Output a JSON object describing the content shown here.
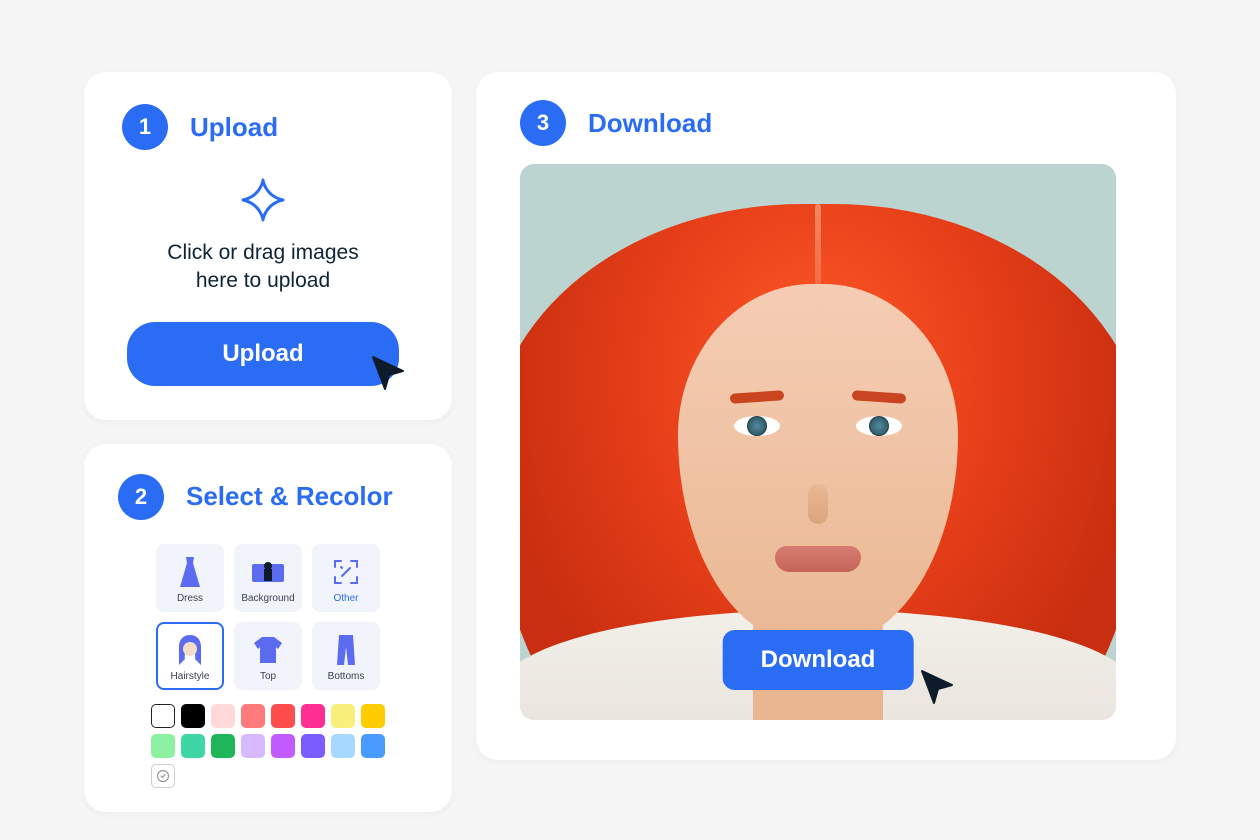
{
  "steps": {
    "upload": {
      "num": "1",
      "title": "Upload"
    },
    "select": {
      "num": "2",
      "title": "Select & Recolor"
    },
    "download": {
      "num": "3",
      "title": "Download"
    }
  },
  "upload": {
    "hint_line1": "Click or drag images",
    "hint_line2": "here to upload",
    "button": "Upload"
  },
  "select": {
    "categories": [
      {
        "id": "dress",
        "label": "Dress",
        "selected": false
      },
      {
        "id": "background",
        "label": "Background",
        "selected": false
      },
      {
        "id": "other",
        "label": "Other",
        "selected": false
      },
      {
        "id": "hairstyle",
        "label": "Hairstyle",
        "selected": true
      },
      {
        "id": "top",
        "label": "Top",
        "selected": false
      },
      {
        "id": "bottoms",
        "label": "Bottoms",
        "selected": false
      }
    ],
    "swatches_row1": [
      "#ffffff",
      "#000000",
      "#ffd8da",
      "#ff7a7a",
      "#ff4d4d",
      "#ff2e93",
      "#f7f07a",
      "#ffcc00"
    ],
    "swatches_row2": [
      "#8ef0a1",
      "#3fd6a6",
      "#1fb65a",
      "#d8b8ff",
      "#c25cff",
      "#7a5cff",
      "#a7d8ff",
      "#4a9bff"
    ]
  },
  "download": {
    "button": "Download"
  },
  "colors": {
    "primary": "#2b6cf5"
  }
}
